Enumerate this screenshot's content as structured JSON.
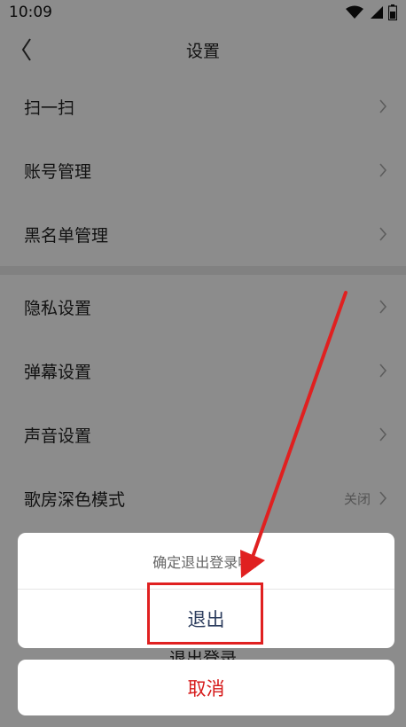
{
  "status_bar": {
    "time": "10:09",
    "icons": [
      "wifi-icon",
      "signal-icon",
      "battery-icon"
    ]
  },
  "nav": {
    "back_icon": "chevron-left-icon",
    "title": "设置"
  },
  "settings": {
    "group1": [
      {
        "label": "扫一扫"
      },
      {
        "label": "账号管理"
      },
      {
        "label": "黑名单管理"
      }
    ],
    "group2": [
      {
        "label": "隐私设置"
      },
      {
        "label": "弹幕设置"
      },
      {
        "label": "声音设置"
      },
      {
        "label": "歌房深色模式",
        "value": "关闭"
      }
    ],
    "logout_label": "退出登录"
  },
  "dialog": {
    "message": "确定退出登录吗?",
    "confirm_label": "退出",
    "cancel_label": "取消"
  },
  "colors": {
    "cancel_text": "#d61a1a",
    "confirm_text": "#2c3d5e",
    "annotation_red": "#e02020"
  }
}
